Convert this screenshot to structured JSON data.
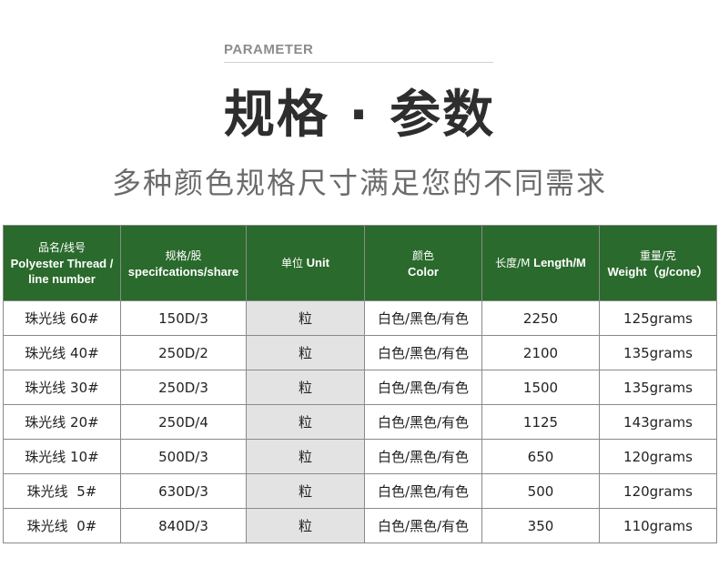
{
  "header": {
    "eyebrow": "PARAMETER",
    "title": "规格 · 参数",
    "subtitle": "多种颜色规格尺寸满足您的不同需求"
  },
  "table": {
    "headers": [
      {
        "zh": "品名/线号",
        "en": "Polyester Thread / line number"
      },
      {
        "zh": "规格/股",
        "en": "specifcations/share"
      },
      {
        "zh": "单位",
        "en": "Unit"
      },
      {
        "zh": "颜色",
        "en": "Color"
      },
      {
        "zh": "长度/M",
        "en": "Length/M"
      },
      {
        "zh": "重量/克",
        "en": "Weight（g/cone）"
      }
    ],
    "rows": [
      [
        "珠光线 60#",
        "150D/3",
        "粒",
        "白色/黑色/有色",
        "2250",
        "125grams"
      ],
      [
        "珠光线 40#",
        "250D/2",
        "粒",
        "白色/黑色/有色",
        "2100",
        "135grams"
      ],
      [
        "珠光线 30#",
        "250D/3",
        "粒",
        "白色/黑色/有色",
        "1500",
        "135grams"
      ],
      [
        "珠光线 20#",
        "250D/4",
        "粒",
        "白色/黑色/有色",
        "1125",
        "143grams"
      ],
      [
        "珠光线 10#",
        "500D/3",
        "粒",
        "白色/黑色/有色",
        "650",
        "120grams"
      ],
      [
        "珠光线  5#",
        "630D/3",
        "粒",
        "白色/黑色/有色",
        "500",
        "120grams"
      ],
      [
        "珠光线  0#",
        "840D/3",
        "粒",
        "白色/黑色/有色",
        "350",
        "110grams"
      ]
    ]
  },
  "colors": {
    "header_bg": "#2a6a2c",
    "shade": "#e3e3e3",
    "title": "#2e2e2e",
    "subtitle": "#6b6b6b"
  }
}
